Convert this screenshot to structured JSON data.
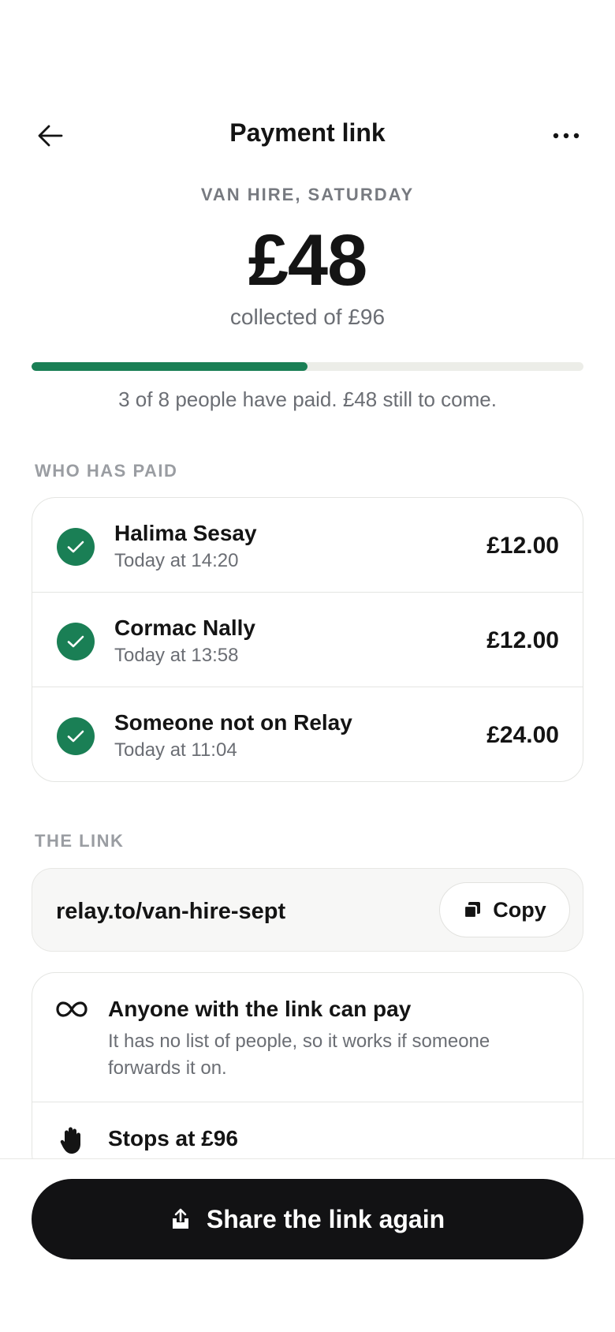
{
  "header": {
    "title": "Payment link",
    "back_icon": "arrow-left-icon",
    "more_icon": "more-horizontal-icon"
  },
  "summary": {
    "eyebrow": "VAN HIRE, SATURDAY",
    "amount": "£48",
    "collected_text": "collected of £96",
    "progress_fraction": 0.5,
    "progress_color": "#1a7f55",
    "progress_note": "3 of 8 people have paid. £48 still to come."
  },
  "who_paid": {
    "label": "WHO HAS PAID",
    "rows": [
      {
        "name": "Halima Sesay",
        "time": "Today at 14:20",
        "amount": "£12.00",
        "icon": "check-circle-icon"
      },
      {
        "name": "Cormac Nally",
        "time": "Today at 13:58",
        "amount": "£12.00",
        "icon": "check-circle-icon"
      },
      {
        "name": "Someone not on Relay",
        "time": "Today at 11:04",
        "amount": "£24.00",
        "icon": "check-circle-icon"
      }
    ]
  },
  "the_link": {
    "label": "THE LINK",
    "url": "relay.to/van-hire-sept",
    "copy_label": "Copy",
    "copy_icon": "copy-icon"
  },
  "info": {
    "anyone": {
      "icon": "infinity-icon",
      "title": "Anyone with the link can pay",
      "desc": "It has no list of people, so it works if someone forwards it on."
    },
    "stops": {
      "icon": "hand-stop-icon",
      "title": "Stops at £96"
    }
  },
  "cta": {
    "label": "Share the link again",
    "icon": "share-icon"
  },
  "colors": {
    "accent_green": "#1a7f55",
    "primary_button": "#121214"
  }
}
